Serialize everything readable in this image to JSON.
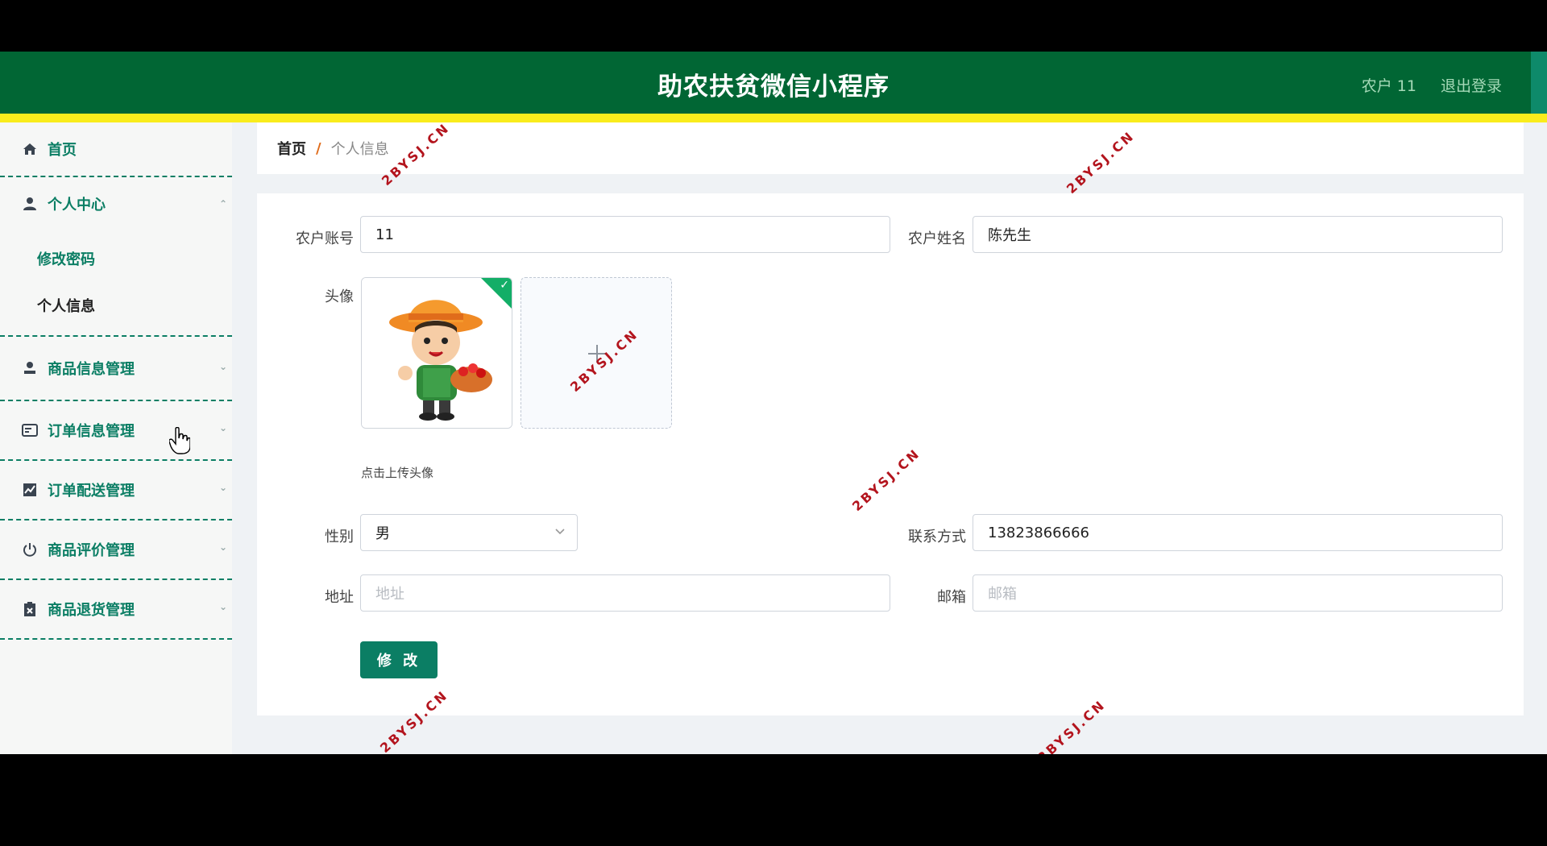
{
  "header": {
    "title": "助农扶贫微信小程序",
    "user": "农户 11",
    "logout": "退出登录"
  },
  "sidebar": {
    "items": [
      {
        "label": "首页",
        "icon": "home-icon"
      },
      {
        "label": "个人中心",
        "icon": "user-icon"
      },
      {
        "label": "商品信息管理",
        "icon": "user-icon"
      },
      {
        "label": "订单信息管理",
        "icon": "card-icon"
      },
      {
        "label": "订单配送管理",
        "icon": "chart-icon"
      },
      {
        "label": "商品评价管理",
        "icon": "power-icon"
      },
      {
        "label": "商品退货管理",
        "icon": "clipboard-icon"
      }
    ],
    "submenu": [
      "修改密码",
      "个人信息"
    ]
  },
  "breadcrumb": {
    "home": "首页",
    "sep": "/",
    "current": "个人信息"
  },
  "form": {
    "account_label": "农户账号",
    "account_value": "11",
    "name_label": "农户姓名",
    "name_value": "陈先生",
    "avatar_label": "头像",
    "upload_hint": "点击上传头像",
    "gender_label": "性别",
    "gender_value": "男",
    "contact_label": "联系方式",
    "contact_value": "13823866666",
    "address_label": "地址",
    "address_placeholder": "地址",
    "email_label": "邮箱",
    "email_placeholder": "邮箱",
    "submit": "修 改"
  },
  "watermark": "2BYSJ.CN",
  "colors": {
    "header": "#016634",
    "accent_strip": "#f9ec1c",
    "primary": "#0b7e64"
  }
}
